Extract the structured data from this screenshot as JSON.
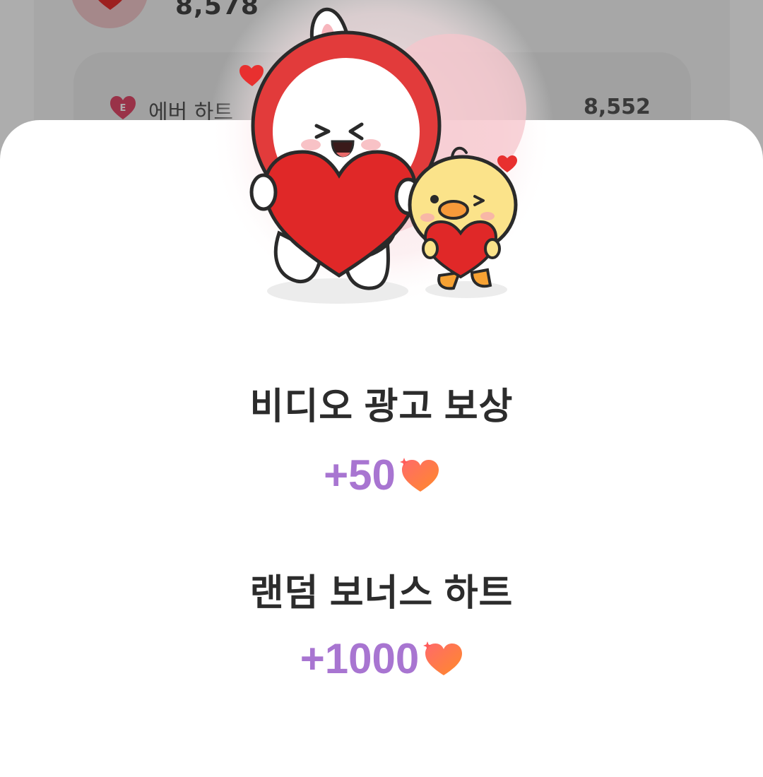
{
  "background": {
    "total_hearts": "8,578",
    "ever_heart": {
      "label": "에버 하트",
      "value": "8,552",
      "badge": "E"
    }
  },
  "reward_popup": {
    "video_reward": {
      "title": "비디오 광고 보상",
      "amount": "+50",
      "icon": "sparkle-heart-icon"
    },
    "bonus_reward": {
      "title": "랜덤 보너스 하트",
      "amount": "+1000",
      "icon": "sparkle-heart-icon"
    },
    "illustration": "bunny-and-chick-holding-hearts"
  },
  "colors": {
    "amount": "#a875d1",
    "heart_red": "#e8302f",
    "overlay": "rgba(0,0,0,0.32)"
  }
}
